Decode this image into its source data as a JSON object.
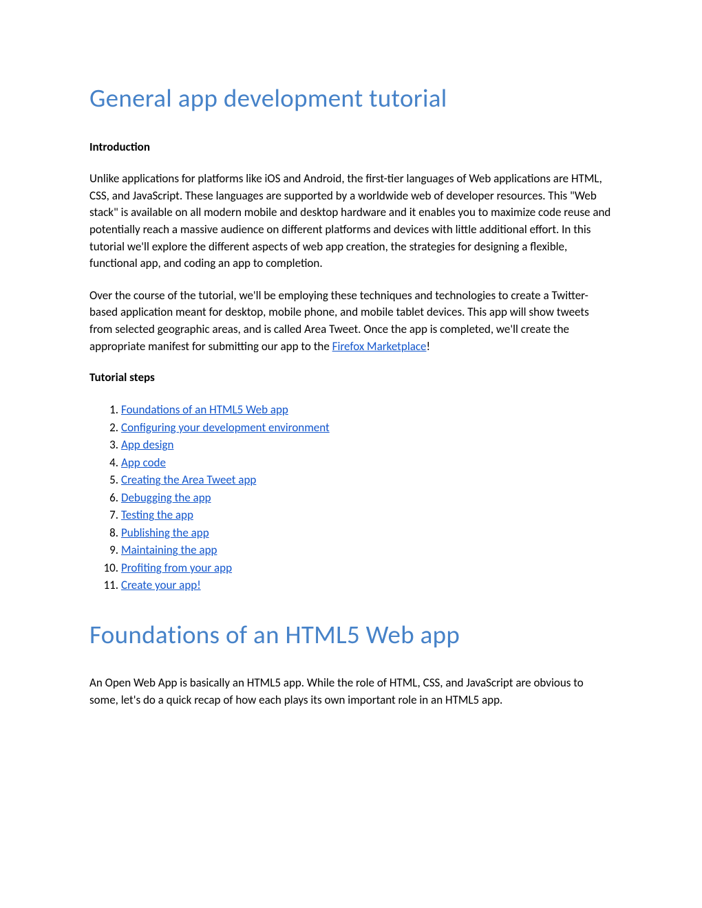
{
  "title": "General app development tutorial",
  "introduction": {
    "heading": "Introduction",
    "paragraph1": "Unlike applications for platforms like iOS and Android, the first-tier languages of Web applications are HTML, CSS, and JavaScript. These languages are supported by a worldwide web of developer resources. This \"Web stack\" is available on all modern mobile and desktop hardware and it enables you to maximize code reuse and potentially reach a massive audience on different platforms and devices with little additional effort. In this tutorial we'll explore the different aspects of web app creation, the strategies for designing a flexible, functional app, and coding an app to completion.",
    "paragraph2_prefix": "Over the course of the tutorial, we'll be employing these techniques and technologies to create a Twitter-based application meant for desktop, mobile phone, and mobile tablet devices. This app will show tweets from selected geographic areas, and is called Area Tweet. Once the app is completed, we'll create the appropriate manifest for submitting our app to the ",
    "paragraph2_link": "Firefox Marketplace",
    "paragraph2_suffix": "!"
  },
  "tutorial_steps": {
    "heading": "Tutorial steps",
    "items": [
      "Foundations of an HTML5 Web app",
      "Configuring your development environment",
      "App design",
      "App code",
      "Creating the Area Tweet app",
      "Debugging the app",
      "Testing the app",
      "Publishing the app",
      "Maintaining the app",
      "Profiting from your app",
      "Create your app!"
    ]
  },
  "section2": {
    "heading": "Foundations of an HTML5 Web app",
    "paragraph": "An Open Web App is basically an HTML5 app. While the role of HTML, CSS, and JavaScript are obvious to some, let's do a quick recap of how each plays its own important role in an HTML5 app."
  }
}
